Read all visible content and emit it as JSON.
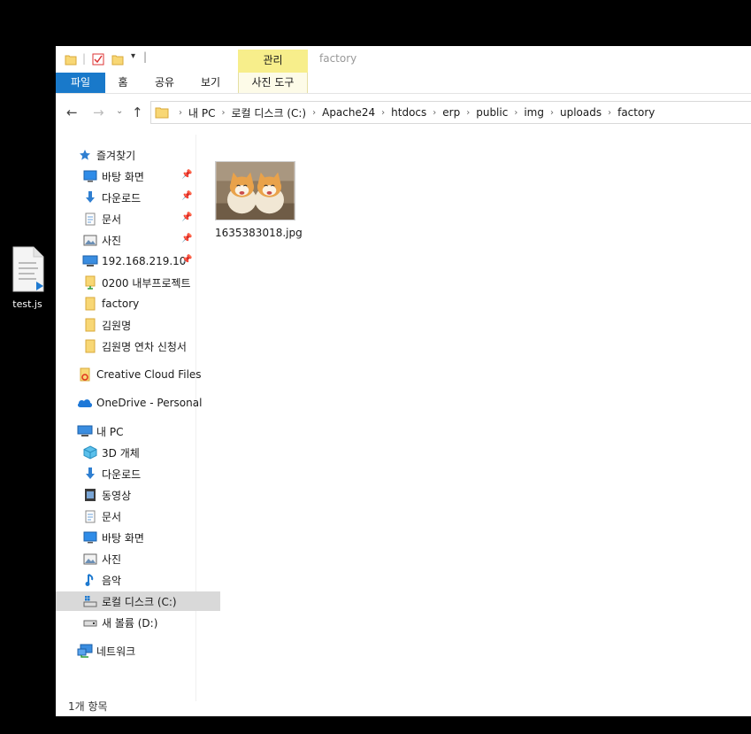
{
  "desktop": {
    "file_label": "test.js"
  },
  "window": {
    "title": "factory",
    "context_tab_label": "관리"
  },
  "ribbon": {
    "tabs": [
      "파일",
      "홈",
      "공유",
      "보기"
    ],
    "context_tab": "사진 도구"
  },
  "address": {
    "crumbs": [
      "내 PC",
      "로컬 디스크 (C:)",
      "Apache24",
      "htdocs",
      "erp",
      "public",
      "img",
      "uploads",
      "factory"
    ]
  },
  "nav": {
    "quick_access": "즐겨찾기",
    "quick_items": [
      {
        "label": "바탕 화면",
        "icon": "desktop-icon"
      },
      {
        "label": "다운로드",
        "icon": "download-arrow-icon"
      },
      {
        "label": "문서",
        "icon": "document-icon"
      },
      {
        "label": "사진",
        "icon": "pictures-icon"
      },
      {
        "label": "192.168.219.10",
        "icon": "network-drive-icon"
      },
      {
        "label": "0200 내부프로젝트",
        "icon": "shared-folder-icon"
      },
      {
        "label": "factory",
        "icon": "folder-icon"
      },
      {
        "label": "김원명",
        "icon": "folder-icon"
      },
      {
        "label": "김원명 연차 신청서",
        "icon": "folder-icon"
      }
    ],
    "creative_cloud": "Creative Cloud Files",
    "onedrive": "OneDrive - Personal",
    "this_pc": "내 PC",
    "pc_items": [
      {
        "label": "3D 개체",
        "icon": "3d-objects-icon"
      },
      {
        "label": "다운로드",
        "icon": "download-arrow-icon"
      },
      {
        "label": "동영상",
        "icon": "video-icon"
      },
      {
        "label": "문서",
        "icon": "document-icon"
      },
      {
        "label": "바탕 화면",
        "icon": "desktop-icon"
      },
      {
        "label": "사진",
        "icon": "pictures-icon"
      },
      {
        "label": "음악",
        "icon": "music-icon"
      },
      {
        "label": "로컬 디스크 (C:)",
        "icon": "local-disk-icon"
      },
      {
        "label": "새 볼륨 (D:)",
        "icon": "drive-icon"
      }
    ],
    "network": "네트워크"
  },
  "content": {
    "files": [
      {
        "name": "1635383018.jpg",
        "icon": "image-thumbnail"
      }
    ]
  },
  "status": {
    "count_text": "1개 항목"
  }
}
